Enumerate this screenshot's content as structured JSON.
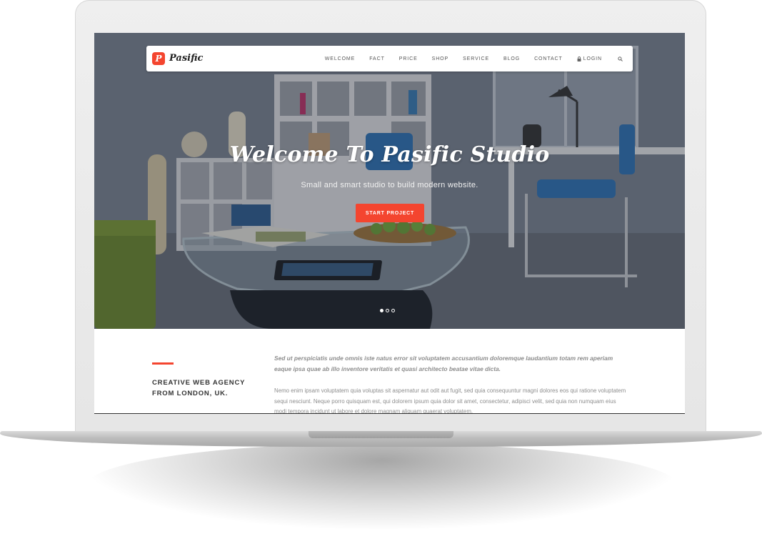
{
  "navbar": {
    "logo_mark": "P",
    "logo_text": "Pasific",
    "items": [
      "WELCOME",
      "FACT",
      "PRICE",
      "SHOP",
      "SERVICE",
      "BLOG",
      "CONTACT",
      "LOGIN"
    ],
    "login_icon": "lock-icon",
    "search_icon": "search-icon"
  },
  "hero": {
    "title": "Welcome To Pasific Studio",
    "subtitle": "Small and smart studio to build modern website.",
    "cta_label": "START PROJECT",
    "slides_total": 3,
    "slide_active": 1
  },
  "content": {
    "heading": "CREATIVE WEB AGENCY FROM LONDON, UK.",
    "lead": "Sed ut perspiciatis unde omnis iste natus error sit voluptatem accusantium doloremque laudantium totam rem aperiam eaque ipsa quae ab illo inventore veritatis et quasi architecto beatae vitae dicta.",
    "body": "Nemo enim ipsam voluptatem quia voluptas sit aspernatur aut odit aut fugit, sed quia consequuntur magni dolores eos qui ratione voluptatem sequi nesciunt. Neque porro quisquam est, qui dolorem ipsum quia dolor sit amet, consectetur, adipisci velit, sed quia non numquam eius modi tempora incidunt ut labore et dolore magnam aliquam quaerat voluptatem."
  },
  "colors": {
    "accent": "#f4452f",
    "nav_text": "#555555",
    "heading_text": "#333333",
    "body_text": "#8e8e8e"
  }
}
